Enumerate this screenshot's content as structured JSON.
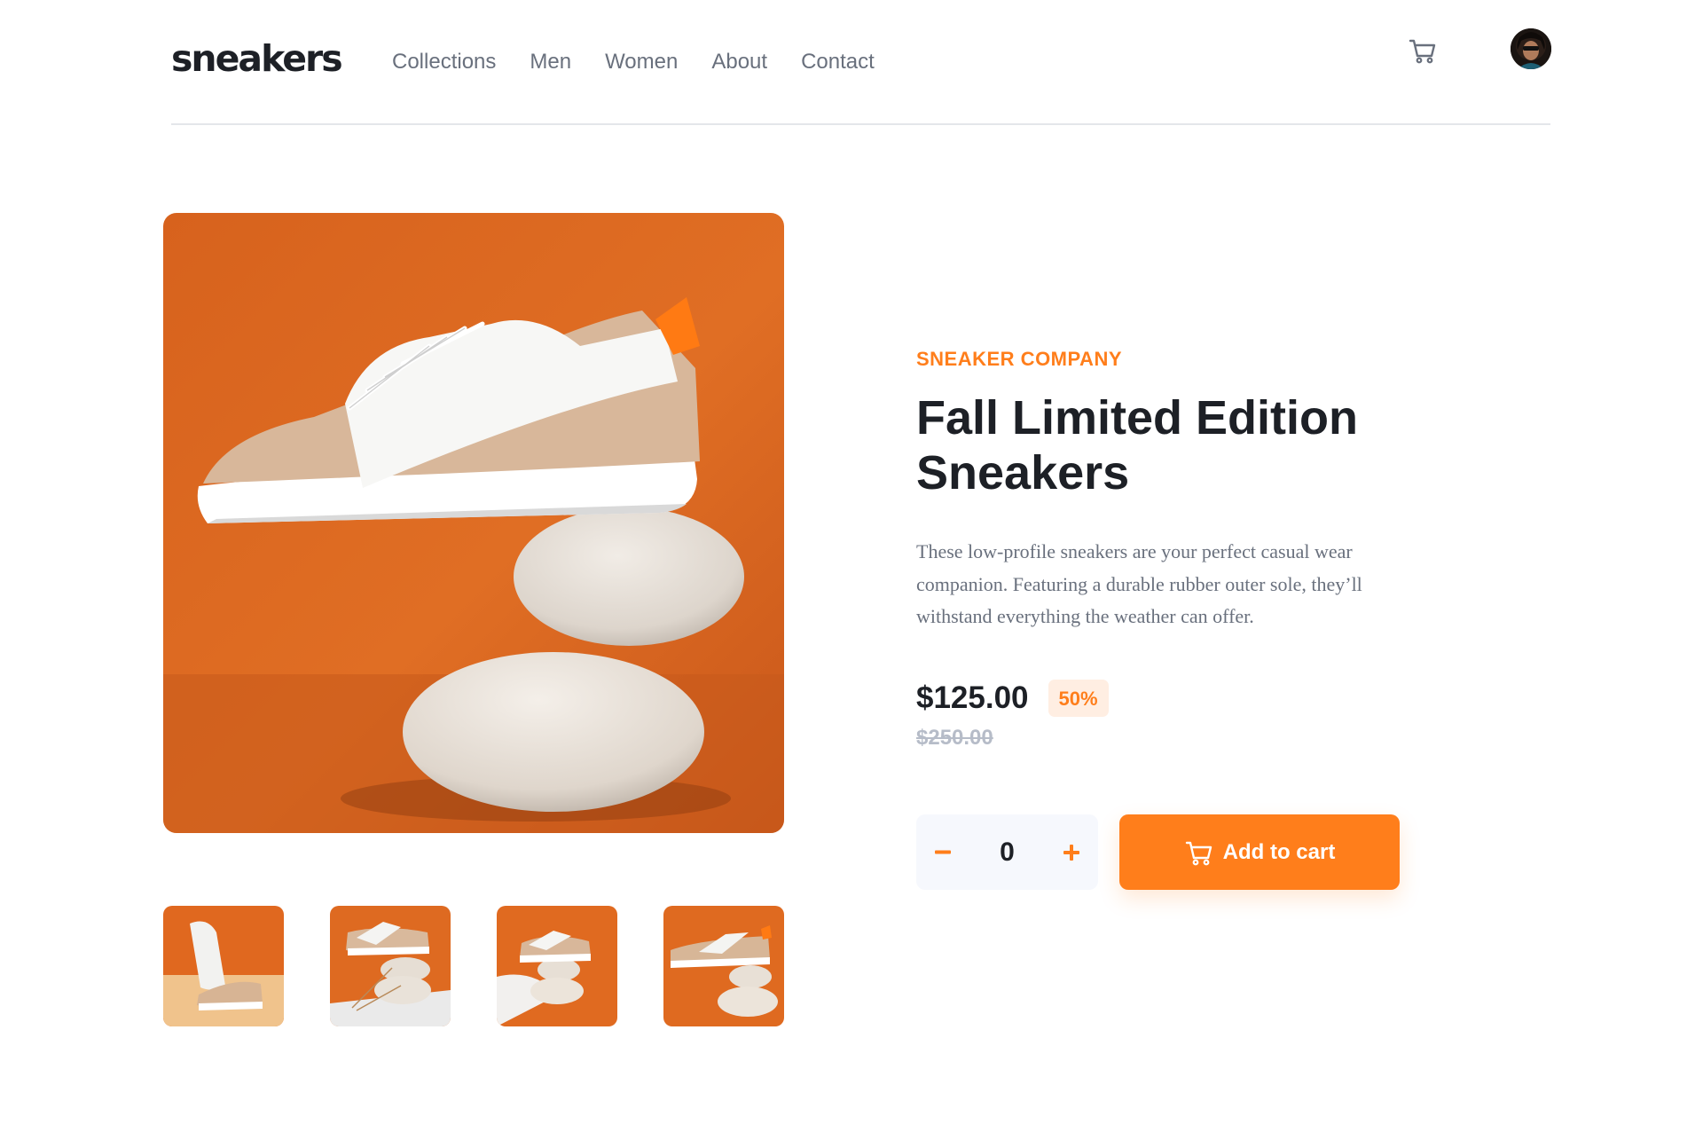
{
  "header": {
    "logo": "sneakers",
    "nav": [
      "Collections",
      "Men",
      "Women",
      "About",
      "Contact"
    ],
    "cart_icon": "cart-icon",
    "avatar_icon": "avatar"
  },
  "product": {
    "company": "SNEAKER COMPANY",
    "title_line1": "Fall Limited Edition",
    "title_line2": "Sneakers",
    "description": "These low-profile sneakers are your perfect casual wear companion. Featuring a durable rubber outer sole, they’ll withstand everything the weather can offer.",
    "price": "$125.00",
    "discount": "50%",
    "old_price": "$250.00",
    "quantity": "0",
    "minus_label": "−",
    "plus_label": "+",
    "add_to_cart": "Add to cart"
  },
  "colors": {
    "accent": "#ff7e1b",
    "accent_pale": "#ffeee2",
    "dark": "#1d2026",
    "grey": "#69707d",
    "light_grey": "#b6bcc8",
    "qty_bg": "#f6f8fd"
  },
  "gallery": {
    "main_image": "product-photo-1",
    "thumbnails": [
      "product-photo-1",
      "product-photo-2",
      "product-photo-3",
      "product-photo-4"
    ]
  }
}
